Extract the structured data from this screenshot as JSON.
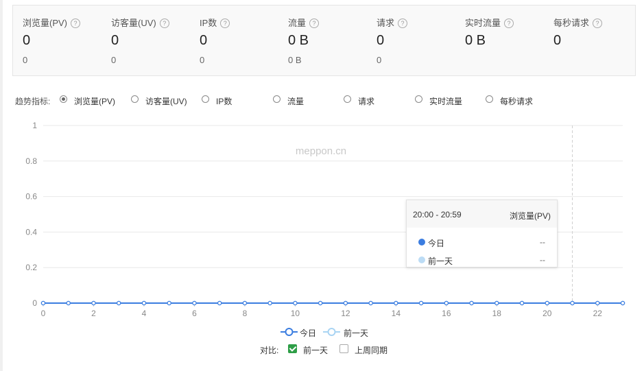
{
  "stats": [
    {
      "label": "浏览量(PV)",
      "value": "0",
      "sub": "0"
    },
    {
      "label": "访客量(UV)",
      "value": "0",
      "sub": "0"
    },
    {
      "label": "IP数",
      "value": "0",
      "sub": "0"
    },
    {
      "label": "流量",
      "value": "0 B",
      "sub": "0 B"
    },
    {
      "label": "请求",
      "value": "0",
      "sub": "0"
    },
    {
      "label": "实时流量",
      "value": "0 B",
      "sub": ""
    },
    {
      "label": "每秒请求",
      "value": "0",
      "sub": ""
    }
  ],
  "help_glyph": "?",
  "trend": {
    "label": "趋势指标:",
    "options": [
      "浏览量(PV)",
      "访客量(UV)",
      "IP数",
      "流量",
      "请求",
      "实时流量",
      "每秒请求"
    ],
    "selected": "浏览量(PV)"
  },
  "watermark": "meppon.cn",
  "chart_data": {
    "type": "line",
    "x": [
      0,
      1,
      2,
      3,
      4,
      5,
      6,
      7,
      8,
      9,
      10,
      11,
      12,
      13,
      14,
      15,
      16,
      17,
      18,
      19,
      20,
      21,
      22,
      23
    ],
    "xticks": [
      "0",
      "2",
      "4",
      "6",
      "8",
      "10",
      "12",
      "14",
      "16",
      "18",
      "20",
      "22"
    ],
    "yticks": [
      "0",
      "0.2",
      "0.4",
      "0.6",
      "0.8",
      "1"
    ],
    "ylim": [
      0,
      1
    ],
    "xlim": [
      0,
      23
    ],
    "grid": true,
    "legend_position": "bottom",
    "highlight_x": 21,
    "series": [
      {
        "name": "今日",
        "color": "#3b7de0",
        "values": [
          0,
          0,
          0,
          0,
          0,
          0,
          0,
          0,
          0,
          0,
          0,
          0,
          0,
          0,
          0,
          0,
          0,
          0,
          0,
          0,
          0,
          0,
          0,
          0
        ]
      },
      {
        "name": "前一天",
        "color": "#a9d4f3",
        "values": [
          0,
          0,
          0,
          0,
          0,
          0,
          0,
          0,
          0,
          0,
          0,
          0,
          0,
          0,
          0,
          0,
          0,
          0,
          0,
          0,
          0,
          0,
          0,
          0
        ]
      }
    ]
  },
  "tooltip": {
    "range": "20:00 - 20:59",
    "metric": "浏览量(PV)",
    "rows": [
      {
        "name": "今日",
        "value": "--",
        "color": "#3b7de0"
      },
      {
        "name": "前一天",
        "value": "--",
        "color": "#bcdcf5"
      }
    ]
  },
  "legend": [
    "今日",
    "前一天"
  ],
  "compare": {
    "label": "对比:",
    "options": [
      {
        "label": "前一天",
        "checked": true
      },
      {
        "label": "上周同期",
        "checked": false
      }
    ]
  }
}
